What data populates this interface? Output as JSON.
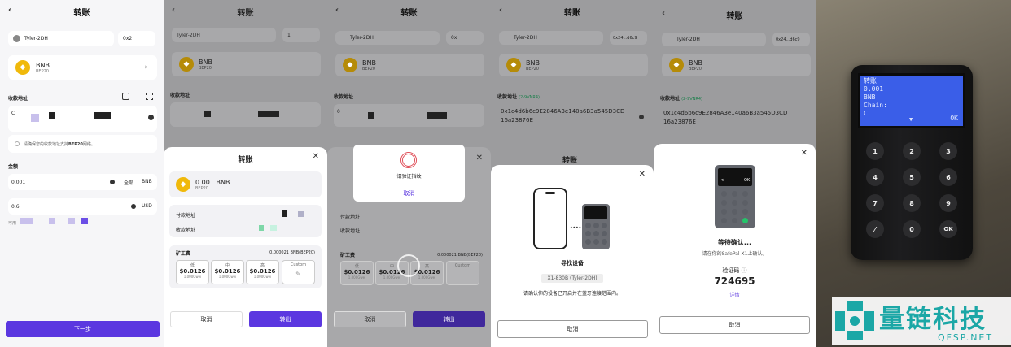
{
  "title": "转账",
  "back_icon": "‹",
  "wallet": {
    "name": "Tyler-2DH",
    "addr1": "0x2",
    "addr2": "1",
    "addr3": "0x",
    "addr4": "0x24...d6c9"
  },
  "token": {
    "symbol": "BNB",
    "network": "BEP20"
  },
  "recv": {
    "label": "收款地址",
    "chain_tag": "(2-9VNR4)",
    "prefix": "C",
    "prefix2": "0",
    "address": "0x1c4d6b6c9E2846A3e140a6B3a545D3CD16a23876E",
    "hint": "请确保您的收款地址支持BEP20网络。",
    "hint_a": "请确保您的收款地址支持",
    "hint_b": "BEP20",
    "hint_c": "网络。"
  },
  "amount": {
    "label": "金额",
    "value": "0.001",
    "all": "全部",
    "unit": "BNB",
    "usd_value": "0.6",
    "usd_unit": "USD",
    "avail": "可用"
  },
  "next_btn": "下一步",
  "confirm": {
    "title": "转账",
    "amount": "0.001",
    "unit": "BNB",
    "network": "BEP20",
    "from_label": "付款地址",
    "to_label": "收款地址",
    "fee_label": "矿工费",
    "fee_value": "0.000021 BNB(BEP20)",
    "fees": [
      {
        "name": "低",
        "usd": "$0.0126",
        "gwei": "1.000Gwei"
      },
      {
        "name": "中",
        "usd": "$0.0126",
        "gwei": "1.000Gwei"
      },
      {
        "name": "高",
        "usd": "$0.0126",
        "gwei": "1.000Gwei"
      }
    ],
    "custom": "Custom",
    "cancel": "取消",
    "submit": "转出"
  },
  "fingerprint": {
    "prompt": "请验证指纹",
    "cancel": "取消"
  },
  "find": {
    "title": "寻找设备",
    "device": "X1-830B (Tyler-2DH)",
    "hint": "请确认你的设备已开启并在蓝牙连接范围内。",
    "cancel": "取消"
  },
  "wait": {
    "title": "等待确认...",
    "hint": "请在你的SafePal X1上确认。",
    "code_label": "验证码",
    "code": "724695",
    "details": "详情",
    "cancel": "取消"
  },
  "device_screen": {
    "line1": "转账",
    "line2": "0.001",
    "line3": "BNB",
    "line4": "Chain:",
    "line5": "C",
    "ok": "OK"
  },
  "mini_screen": {
    "left": "<",
    "right": "OK"
  },
  "keypad": [
    {
      "n": "1",
      "s": "@"
    },
    {
      "n": "2",
      "s": "ABC"
    },
    {
      "n": "3",
      "s": "DEF"
    },
    {
      "n": "4",
      "s": "GHI"
    },
    {
      "n": "5",
      "s": "JKL"
    },
    {
      "n": "6",
      "s": "MNO"
    },
    {
      "n": "7",
      "s": "PQRS"
    },
    {
      "n": "8",
      "s": "TUV"
    },
    {
      "n": "9",
      "s": "WXYZ"
    },
    {
      "n": "⁄",
      "s": ""
    },
    {
      "n": "0",
      "s": ""
    },
    {
      "n": "OK",
      "s": ""
    }
  ],
  "watermark": {
    "cn": "量链科技",
    "en": "QFSP.NET"
  },
  "colors": {
    "accent": "#5b37e0",
    "bnb": "#f0b90b",
    "device_screen": "#3a5ee8",
    "brand_teal": "#1ba7a6"
  }
}
